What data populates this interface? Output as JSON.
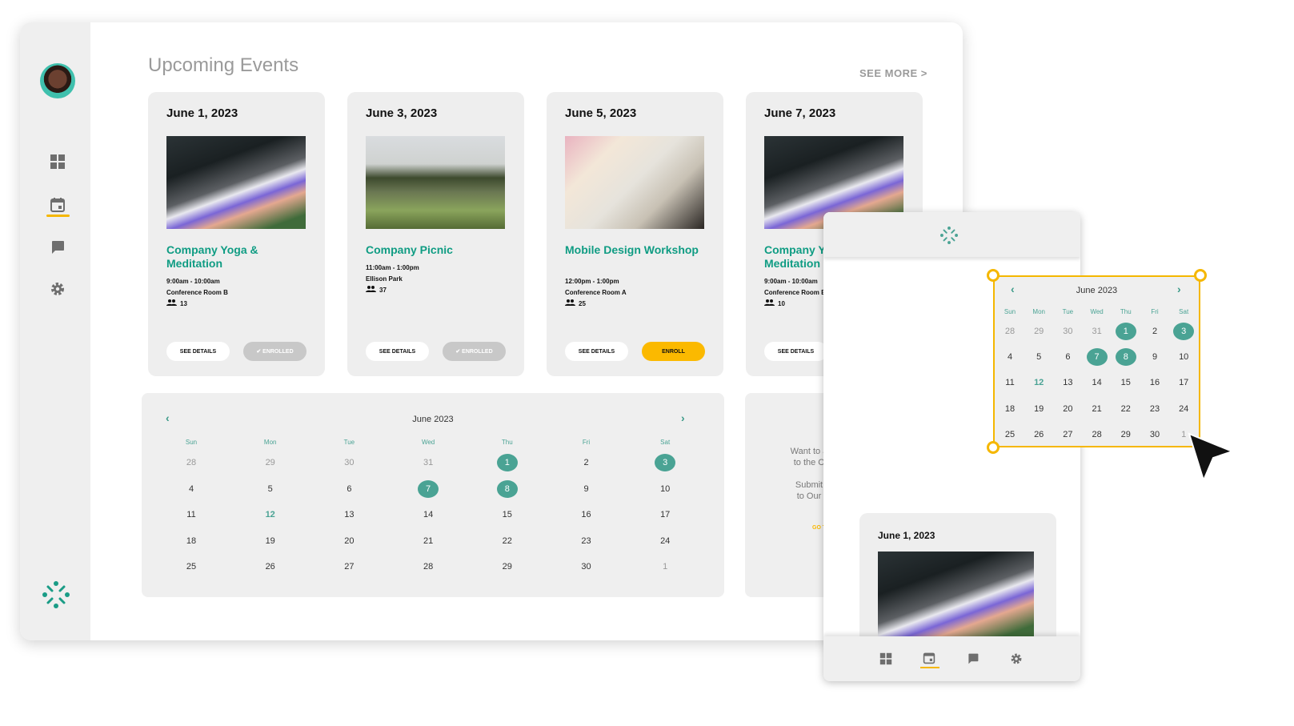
{
  "page": {
    "title": "Upcoming Events",
    "see_more": "SEE MORE >"
  },
  "colors": {
    "accent": "#0f9c83",
    "event_dot": "#4aa394",
    "enroll": "#fbb900",
    "enrolled": "#c8c8c8",
    "selection": "#f5b700"
  },
  "sidebar": {
    "items": [
      {
        "icon": "dashboard-grid-icon"
      },
      {
        "icon": "calendar-icon",
        "active": true
      },
      {
        "icon": "chat-icon"
      },
      {
        "icon": "gear-icon"
      }
    ],
    "logo": "sparkle-logo"
  },
  "events": [
    {
      "date": "June 1, 2023",
      "title": "Company Yoga & Meditation",
      "time": "9:00am - 10:00am",
      "location": "Conference Room B",
      "attendees": "13",
      "details": "SEE DETAILS",
      "action": "✔ ENROLLED",
      "state": "enrolled"
    },
    {
      "date": "June 3, 2023",
      "title": "Company Picnic",
      "time": "11:00am - 1:00pm",
      "location": "Ellison Park",
      "attendees": "37",
      "details": "SEE DETAILS",
      "action": "✔ ENROLLED",
      "state": "enrolled"
    },
    {
      "date": "June 5, 2023",
      "title": "Mobile Design Workshop",
      "time": "12:00pm - 1:00pm",
      "location": "Conference Room A",
      "attendees": "25",
      "details": "SEE DETAILS",
      "action": "ENROLL",
      "state": "enroll"
    },
    {
      "date": "June 7, 2023",
      "title": "Company Yoga & Meditation",
      "time": "9:00am - 10:00am",
      "location": "Conference Room B",
      "attendees": "10",
      "details": "SEE DETAILS",
      "action": "",
      "state": "hidden"
    }
  ],
  "calendar": {
    "month": "June 2023",
    "prev": "‹",
    "next": "›",
    "days": [
      "Sun",
      "Mon",
      "Tue",
      "Wed",
      "Thu",
      "Fri",
      "Sat"
    ],
    "weeks": [
      [
        "28",
        "29",
        "30",
        "31",
        "1",
        "2",
        "3"
      ],
      [
        "4",
        "5",
        "6",
        "7",
        "8",
        "9",
        "10"
      ],
      [
        "11",
        "12",
        "13",
        "14",
        "15",
        "16",
        "17"
      ],
      [
        "18",
        "19",
        "20",
        "21",
        "22",
        "23",
        "24"
      ],
      [
        "25",
        "26",
        "27",
        "28",
        "29",
        "30",
        "1"
      ]
    ],
    "muted": [
      [
        0,
        0
      ],
      [
        0,
        1
      ],
      [
        0,
        2
      ],
      [
        0,
        3
      ],
      [
        4,
        6
      ]
    ],
    "events": [
      [
        0,
        4
      ],
      [
        0,
        6
      ],
      [
        1,
        3
      ],
      [
        1,
        4
      ]
    ],
    "today": [
      2,
      1
    ]
  },
  "side_panel": {
    "line1": "Want to a",
    "line2": "to the C",
    "line3": "Submit",
    "line4": "to Our",
    "button": "GO T"
  },
  "mobile": {
    "card_date": "June 1, 2023",
    "nav": [
      "dashboard-grid-icon",
      "calendar-icon",
      "chat-icon",
      "gear-icon"
    ]
  }
}
